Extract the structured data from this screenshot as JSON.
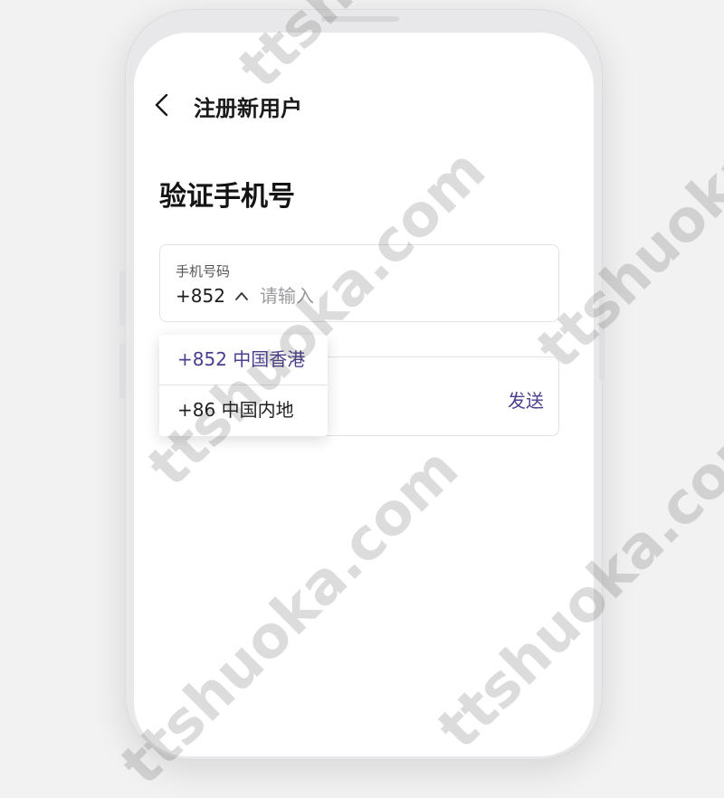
{
  "nav": {
    "title": "注册新用户",
    "back_icon": "chevron-left-icon"
  },
  "heading": "验证手机号",
  "phone_field": {
    "label": "手机号码",
    "country_code": "+852",
    "chevron_icon": "chevron-up-icon",
    "value": "",
    "placeholder": "请输入"
  },
  "code_field": {
    "send_label": "发送"
  },
  "country_dropdown": {
    "options": [
      {
        "label": "+852 中国香港",
        "selected": true
      },
      {
        "label": "+86 中国内地",
        "selected": false
      }
    ]
  },
  "watermark": "ttshuoka.com",
  "colors": {
    "accent": "#4a3f8f",
    "border": "#e3e3e6",
    "text": "#1a1a1a"
  }
}
